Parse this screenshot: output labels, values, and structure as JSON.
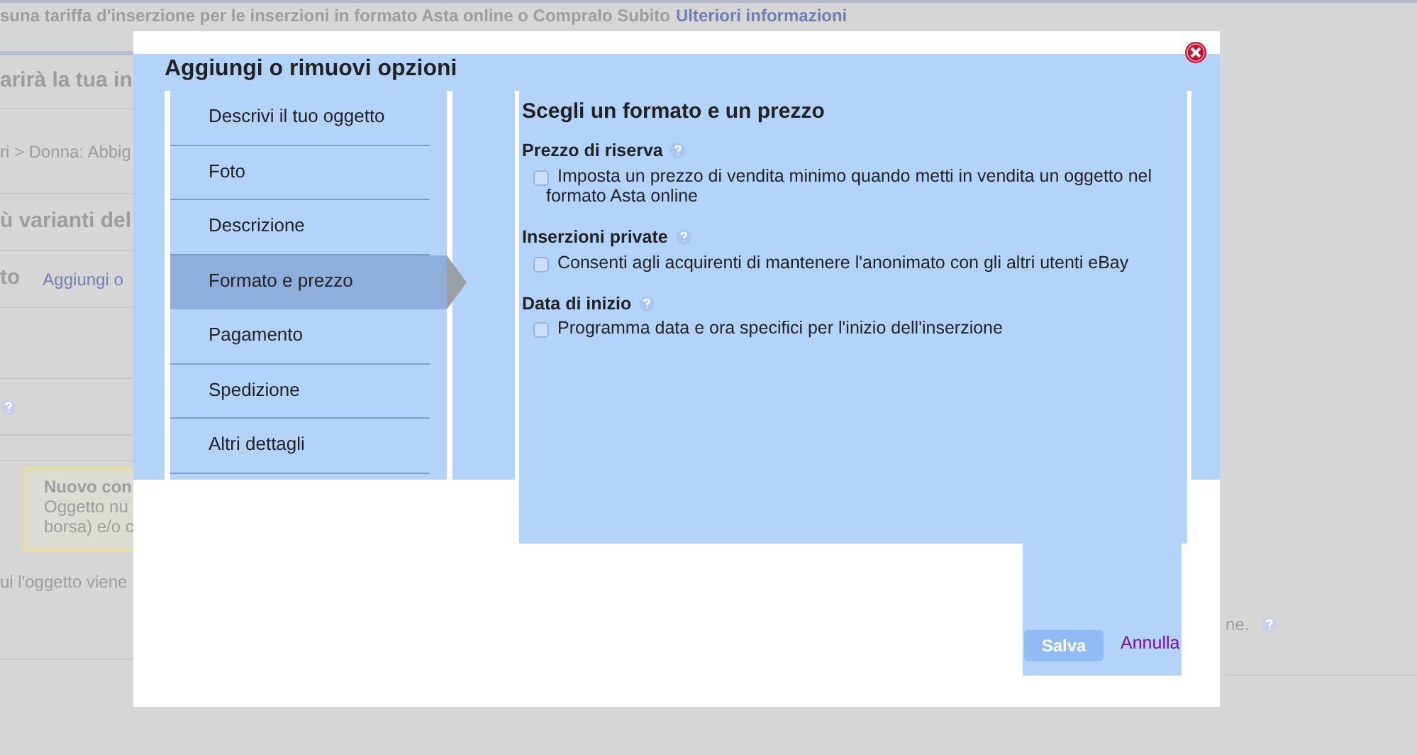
{
  "page": {
    "notice": "suna tariffa d'inserzione per le inserzioni in formato Asta online o Compralo Subito",
    "notice_link": "Ulteriori informazioni",
    "heading_1": "arirà la tua in",
    "breadcrumb": "ri > Donna: Abbig",
    "heading_2": "ù varianti del",
    "row_label": "to",
    "row_link": "Aggiungi o",
    "tip": {
      "title": "Nuovo con",
      "lines": [
        "Oggetto nu",
        "borsa) e/o c"
      ]
    },
    "footer_text": "ui l'oggetto viene",
    "footer_text_end": "ne."
  },
  "dialog": {
    "title": "Aggiungi o rimuovi opzioni",
    "nav": [
      {
        "label": "Descrivi il tuo oggetto",
        "selected": false
      },
      {
        "label": "Foto",
        "selected": false
      },
      {
        "label": "Descrizione",
        "selected": false
      },
      {
        "label": "Formato e prezzo",
        "selected": true
      },
      {
        "label": "Pagamento",
        "selected": false
      },
      {
        "label": "Spedizione",
        "selected": false
      },
      {
        "label": "Altri dettagli",
        "selected": false
      }
    ],
    "section_title": "Scegli un formato e un prezzo",
    "options": [
      {
        "heading": "Prezzo di riserva",
        "label": "Imposta un prezzo di vendita minimo quando metti in vendita un oggetto nel formato Asta online",
        "checked": false
      },
      {
        "heading": "Inserzioni private",
        "label": "Consenti agli acquirenti di mantenere l'anonimato con gli altri utenti eBay",
        "checked": false
      },
      {
        "heading": "Data di inizio",
        "label": "Programma data e ora specifici per l'inizio dell'inserzione",
        "checked": false
      }
    ],
    "save": "Salva",
    "cancel": "Annulla"
  }
}
